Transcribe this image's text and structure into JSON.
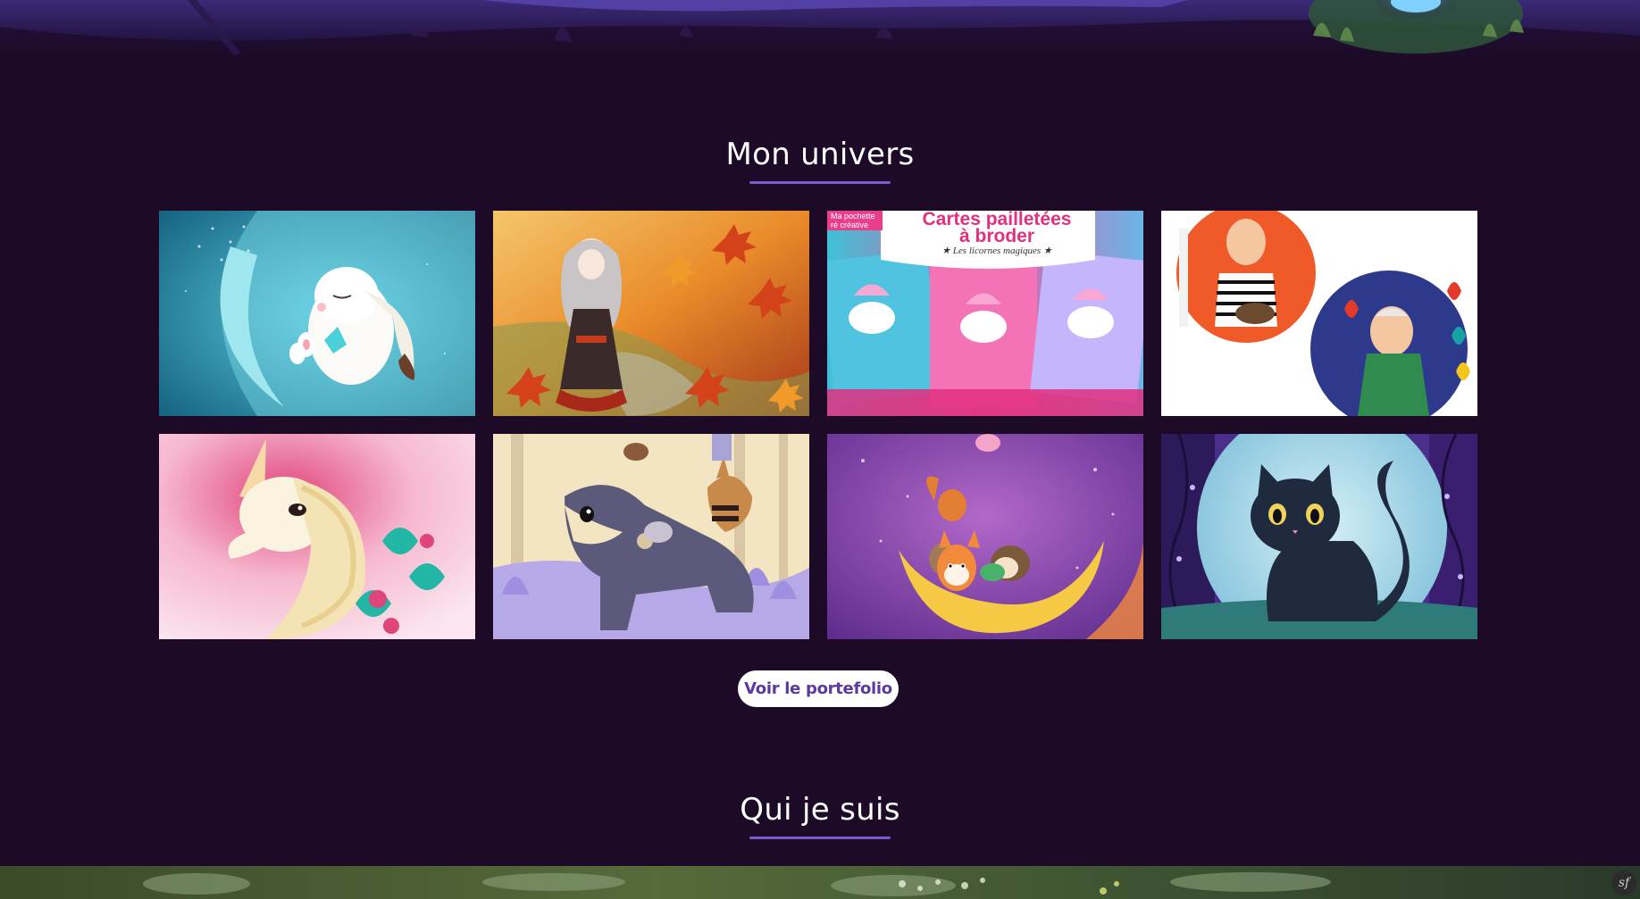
{
  "sections": {
    "univers": {
      "title": "Mon univers"
    },
    "qui": {
      "title": "Qui je suis"
    }
  },
  "gallery": {
    "items": [
      {
        "subject": "white bunny sleeping on crescent moon",
        "palette": [
          "#1a8fb0",
          "#6fd3e6",
          "#ffffff"
        ]
      },
      {
        "subject": "girl in autumn maple leaves",
        "palette": [
          "#c2410c",
          "#f59e0b",
          "#fbbf24"
        ]
      },
      {
        "subject": "glitter cards to embroider, magic unicorns",
        "palette": [
          "#e91e8c",
          "#38bdf8",
          "#f9a8d4"
        ],
        "text": {
          "tag_line1": "Ma pochette",
          "tag_line2": "ré créative",
          "title_line1": "Cartes pailletées",
          "title_line2": "à broder",
          "subtitle": "★ Les licornes magiques ★"
        }
      },
      {
        "subject": "two painters portraits in circles",
        "palette": [
          "#f05a28",
          "#2d3a8c",
          "#ffffff"
        ]
      },
      {
        "subject": "unicorn with flowers",
        "palette": [
          "#f8c7d8",
          "#e0457a",
          "#f3e3b5"
        ]
      },
      {
        "subject": "grey wolf in lavender forest with birds",
        "palette": [
          "#b7a8e8",
          "#f3e4c2",
          "#5c5a7a"
        ]
      },
      {
        "subject": "forest animals on a crescent moon",
        "palette": [
          "#8a3fb0",
          "#f6c945",
          "#f28a3c"
        ]
      },
      {
        "subject": "black cat under full moon",
        "palette": [
          "#4a2e8a",
          "#a6d8e8",
          "#1f2a3f"
        ]
      }
    ]
  },
  "portfolio_button": {
    "label": "Voir le portefolio"
  },
  "debug_toolbar": {
    "label": "sf"
  },
  "colors": {
    "background": "#1c0a26",
    "accent": "#7a5bd0",
    "button_text": "#5b3a9e"
  }
}
